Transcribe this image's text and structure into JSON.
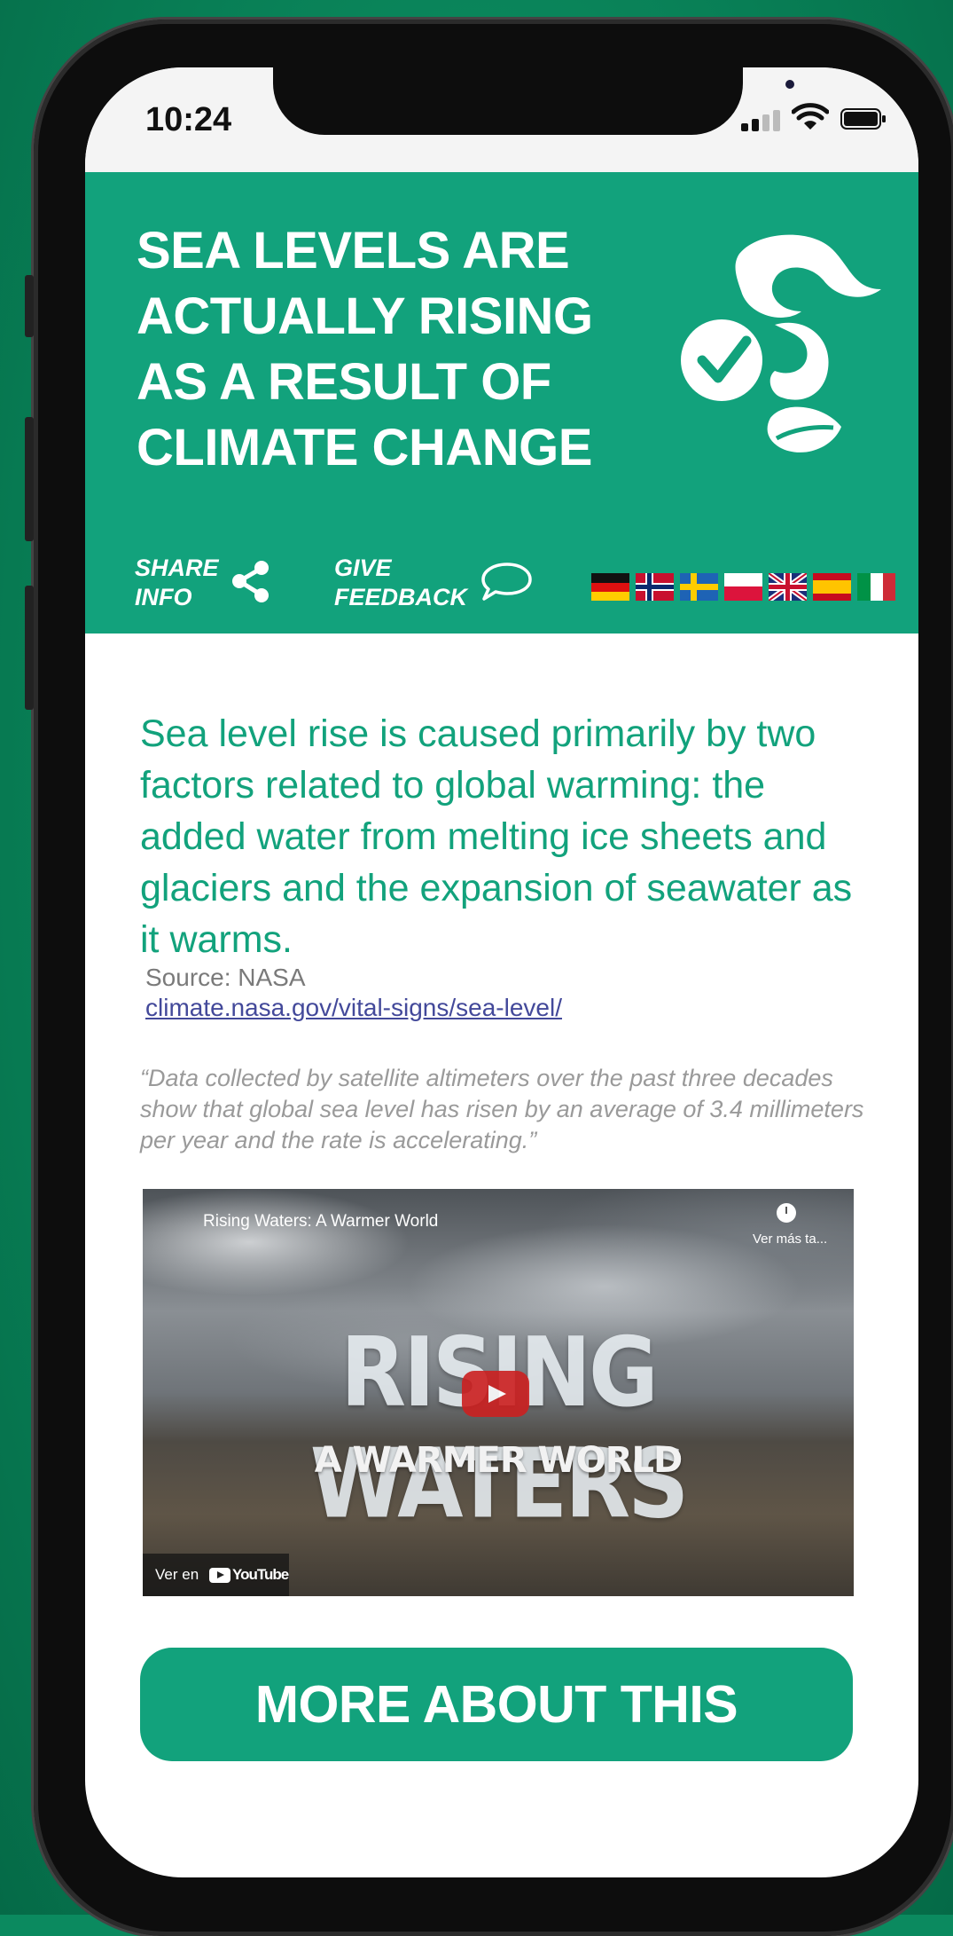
{
  "status": {
    "time": "10:24"
  },
  "header": {
    "title": "SEA LEVELS ARE ACTUALLY RISING AS A RESULT OF CLIMATE CHANGE",
    "share_line1": "SHARE",
    "share_line2": "INFO",
    "feedback_line1": "GIVE",
    "feedback_line2": "FEEDBACK",
    "flags": [
      "germany-flag",
      "norway-flag",
      "sweden-flag",
      "poland-flag",
      "uk-flag",
      "spain-flag",
      "italy-flag"
    ]
  },
  "content": {
    "lead": "Sea level rise is caused primarily by two factors related to global warming: the added water from melting ice sheets and glaciers and the expansion of seawater as it warms.",
    "source_label": "Source: NASA",
    "source_link": "climate.nasa.gov/vital-signs/sea-level/",
    "quote": "“Data collected by satellite altimeters over the past three decades show that global sea level has risen by an average of 3.4 millimeters per year and the rate is accelerating.”"
  },
  "video": {
    "title": "Rising Waters: A Warmer World",
    "watch_later": "Ver más ta...",
    "big_title": "RISING WATERS",
    "subtitle": "A WARMER WORLD",
    "watch_on": "Ver en",
    "youtube": "YouTube"
  },
  "cta": {
    "label": "MORE ABOUT THIS"
  },
  "colors": {
    "brand": "#12a27c",
    "link": "#43499a",
    "background": "#0b8a5f"
  }
}
